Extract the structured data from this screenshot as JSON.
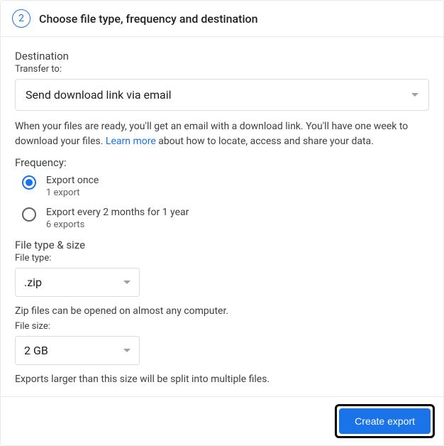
{
  "header": {
    "step_number": "2",
    "title": "Choose file type, frequency and destination"
  },
  "destination": {
    "title": "Destination",
    "transfer_label": "Transfer to:",
    "transfer_value": "Send download link via email",
    "help_text_before": "When your files are ready, you'll get an email with a download link. You'll have one week to download your files. ",
    "learn_more": "Learn more",
    "help_text_after": " about how to locate, access and share your data."
  },
  "frequency": {
    "title": "Frequency:",
    "options": [
      {
        "label": "Export once",
        "sub": "1 export",
        "selected": true
      },
      {
        "label": "Export every 2 months for 1 year",
        "sub": "6 exports",
        "selected": false
      }
    ]
  },
  "file_type": {
    "title": "File type & size",
    "type_label": "File type:",
    "type_value": ".zip",
    "type_desc": "Zip files can be opened on almost any computer.",
    "size_label": "File size:",
    "size_value": "2 GB",
    "size_desc": "Exports larger than this size will be split into multiple files."
  },
  "footer": {
    "button": "Create export"
  }
}
